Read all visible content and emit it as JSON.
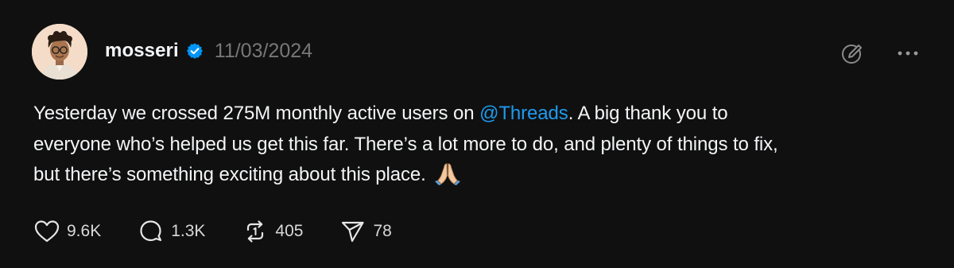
{
  "post": {
    "author": {
      "username": "mosseri",
      "verified": true,
      "avatar": "cartoon-avatar"
    },
    "date": "11/03/2024",
    "text": {
      "line1_before": "Yesterday we crossed 275M monthly active users on ",
      "mention": "@Threads",
      "line1_after": ". A big thank you to",
      "line2": "everyone who’s helped us get this far. There’s a lot more to do, and plenty of things to fix,",
      "line3": "but there’s something exciting about this place.",
      "emoji": "folded-hands-emoji"
    },
    "actions": {
      "like_count": "9.6K",
      "reply_count": "1.3K",
      "repost_count": "405",
      "share_count": "78"
    },
    "icons": {
      "edit": "edit-icon",
      "more": "more-icon",
      "like": "heart-icon",
      "reply": "comment-icon",
      "repost": "repost-icon",
      "share": "send-icon"
    },
    "colors": {
      "background": "#101010",
      "text": "#f3f5f7",
      "muted": "#777777",
      "link": "#1d9bf0",
      "verified": "#0095f6"
    }
  }
}
